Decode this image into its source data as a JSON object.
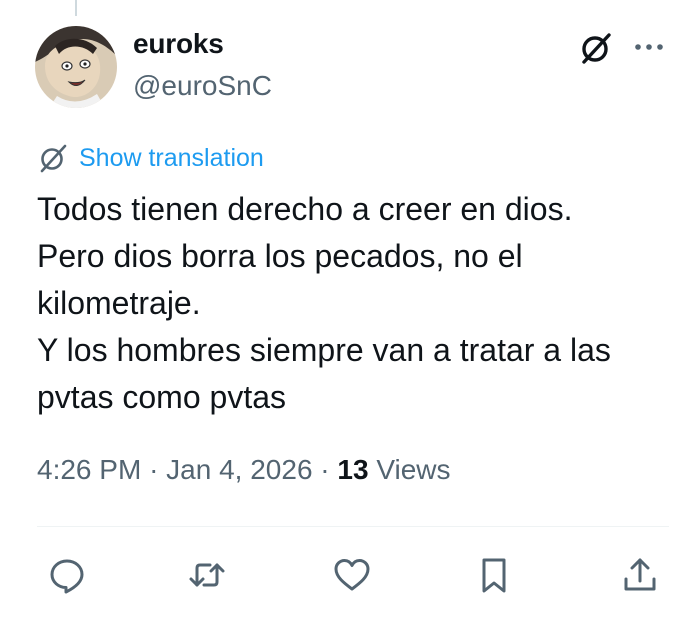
{
  "user": {
    "display_name": "euroks",
    "handle": "@euroSnC"
  },
  "header_icons": [
    "grok-icon",
    "more-options-icon"
  ],
  "translation": {
    "label": "Show translation",
    "icon": "translate-icon"
  },
  "tweet": {
    "lines": [
      "Todos tienen derecho a creer en dios.",
      "Pero dios borra los pecados, no el",
      "kilometraje.",
      "Y los hombres siempre van a tratar a las",
      "pvtas como pvtas"
    ]
  },
  "meta": {
    "time": "4:26 PM",
    "separator": "·",
    "date": "Jan 4, 2026",
    "views_count": "13",
    "views_label": "Views"
  },
  "actions": [
    "reply-icon",
    "retweet-icon",
    "like-icon",
    "bookmark-icon",
    "share-icon"
  ],
  "colors": {
    "link": "#1d9bf0",
    "text": "#0f1419",
    "secondary": "#536471",
    "divider": "#eff3f4"
  }
}
